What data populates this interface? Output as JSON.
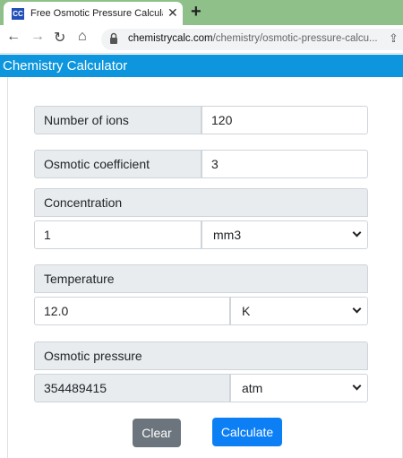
{
  "browser": {
    "tab_title": "Free Osmotic Pressure Calculator",
    "favicon_text": "CC",
    "url_host": "chemistrycalc.com",
    "url_path": "/chemistry/osmotic-pressure-calcu..."
  },
  "site": {
    "title": "Chemistry Calculator"
  },
  "form": {
    "ions": {
      "label": "Number of ions",
      "value": "120"
    },
    "osmotic_coefficient": {
      "label": "Osmotic coefficient",
      "value": "3"
    },
    "concentration": {
      "label": "Concentration",
      "value": "1",
      "unit": "mm3"
    },
    "temperature": {
      "label": "Temperature",
      "value": "12.0",
      "unit": "K"
    },
    "osmotic_pressure": {
      "label": "Osmotic pressure",
      "value": "354489415",
      "unit": "atm"
    }
  },
  "buttons": {
    "clear": "Clear",
    "calculate": "Calculate"
  },
  "colors": {
    "tabbar": "#8fc08a",
    "header": "#0d96dd",
    "primary": "#0d7ff5",
    "secondary": "#6c757d"
  }
}
